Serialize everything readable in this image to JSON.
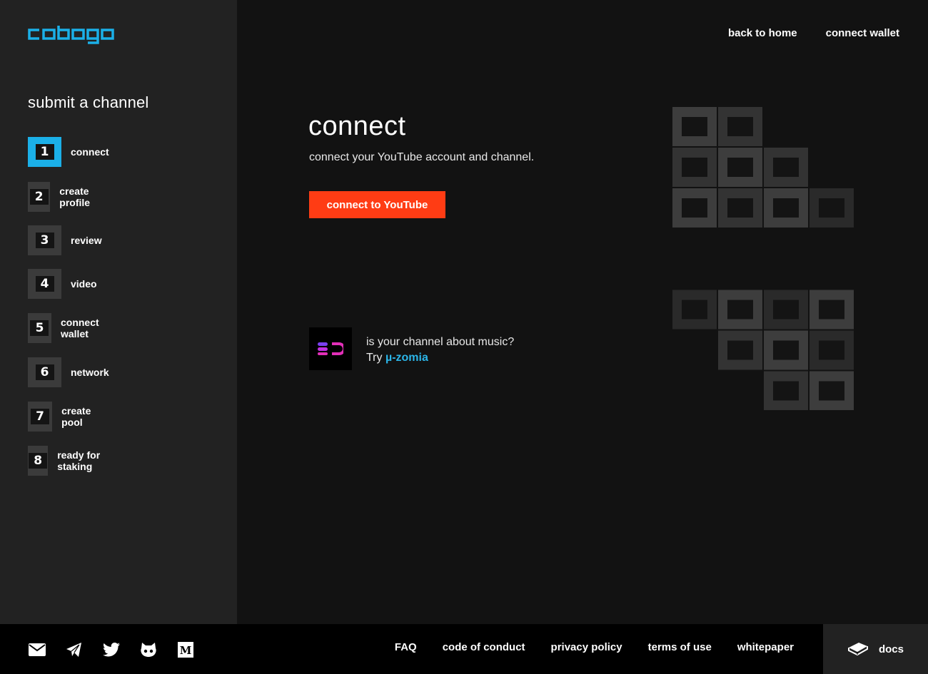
{
  "brand": {
    "name": "cobogo",
    "color": "#1bb0e8"
  },
  "topnav": {
    "back_home": "back to home",
    "connect_wallet": "connect wallet"
  },
  "sidebar": {
    "title": "submit a channel",
    "active_step": 1,
    "steps": [
      {
        "num": "1",
        "label": "connect"
      },
      {
        "num": "2",
        "label": "create profile"
      },
      {
        "num": "3",
        "label": "review"
      },
      {
        "num": "4",
        "label": "video"
      },
      {
        "num": "5",
        "label": "connect wallet"
      },
      {
        "num": "6",
        "label": "network"
      },
      {
        "num": "7",
        "label": "create pool"
      },
      {
        "num": "8",
        "label": "ready for staking"
      }
    ]
  },
  "main": {
    "title": "connect",
    "subtitle": "connect your YouTube account and channel.",
    "youtube_button": "connect to YouTube",
    "button_color": "#ff3c14",
    "music_question": "is your channel about music?",
    "music_try": "Try",
    "music_link": "µ-zomia"
  },
  "footer": {
    "social_icons": [
      "mail-icon",
      "telegram-icon",
      "twitter-icon",
      "github-icon",
      "medium-icon"
    ],
    "links": {
      "faq": "FAQ",
      "code_of_conduct": "code of conduct",
      "privacy_policy": "privacy policy",
      "terms_of_use": "terms of use",
      "whitepaper": "whitepaper"
    },
    "docs": "docs"
  }
}
